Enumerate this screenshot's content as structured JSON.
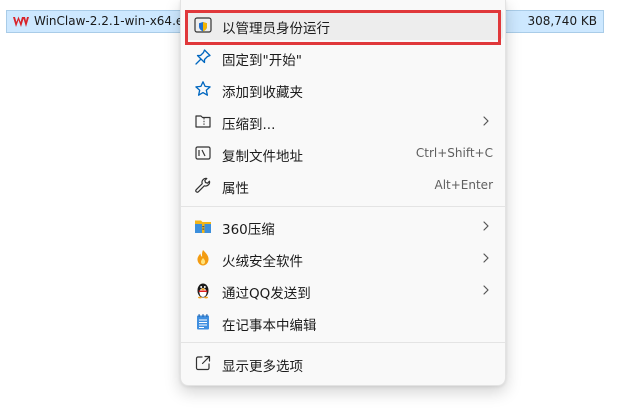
{
  "file": {
    "name": "WinClaw-2.2.1-win-x64.exe",
    "size": "308,740 KB",
    "icon": "winclaw-app-icon"
  },
  "context_menu": {
    "items": [
      {
        "label": "以管理员身份运行",
        "icon": "shield-icon",
        "shortcut": "",
        "submenu": false
      },
      {
        "label": "固定到\"开始\"",
        "icon": "pin-icon",
        "shortcut": "",
        "submenu": false
      },
      {
        "label": "添加到收藏夹",
        "icon": "star-icon",
        "shortcut": "",
        "submenu": false
      },
      {
        "label": "压缩到...",
        "icon": "zip-folder-icon",
        "shortcut": "",
        "submenu": true
      },
      {
        "label": "复制文件地址",
        "icon": "copy-path-icon",
        "shortcut": "Ctrl+Shift+C",
        "submenu": false
      },
      {
        "label": "属性",
        "icon": "wrench-icon",
        "shortcut": "Alt+Enter",
        "submenu": false
      },
      {
        "label": "360压缩",
        "icon": "360-zip-icon",
        "shortcut": "",
        "submenu": true
      },
      {
        "label": "火绒安全软件",
        "icon": "huorong-icon",
        "shortcut": "",
        "submenu": true
      },
      {
        "label": "通过QQ发送到",
        "icon": "qq-penguin-icon",
        "shortcut": "",
        "submenu": true
      },
      {
        "label": "在记事本中编辑",
        "icon": "notepad-icon",
        "shortcut": "",
        "submenu": false
      },
      {
        "label": "显示更多选项",
        "icon": "open-external-icon",
        "shortcut": "",
        "submenu": false
      }
    ]
  },
  "colors": {
    "highlight_border": "#e0383b",
    "selection_bg": "#cde8ff",
    "accent_blue": "#0067c0"
  }
}
